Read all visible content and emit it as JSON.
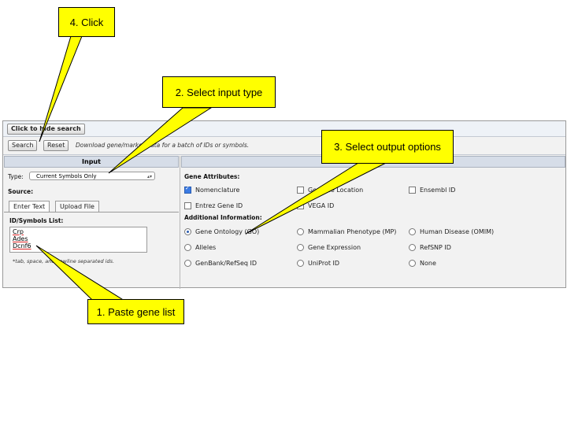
{
  "toolbar": {
    "hide_search_label": "Click to hide search",
    "search_label": "Search",
    "reset_label": "Reset",
    "hint": "Download gene/marker data for a batch of IDs or symbols."
  },
  "input_panel": {
    "header": "Input",
    "type_label": "Type:",
    "type_value": "Current Symbols Only",
    "source_label": "Source:",
    "tabs": [
      "Enter Text",
      "Upload File"
    ],
    "id_list_label": "ID/Symbols List:",
    "genes": [
      "Crp",
      "Ades",
      "Dcnf6"
    ],
    "note": "*tab, space, and newline separated ids."
  },
  "output_panel": {
    "gene_attributes_label": "Gene Attributes:",
    "attributes": [
      {
        "label": "Nomenclature",
        "checked": true
      },
      {
        "label": "Genome Location",
        "checked": false
      },
      {
        "label": "Ensembl ID",
        "checked": false
      },
      {
        "label": "Entrez Gene ID",
        "checked": false
      },
      {
        "label": "VEGA ID",
        "checked": false
      }
    ],
    "additional_label": "Additional Information:",
    "additional": [
      {
        "label": "Gene Ontology (GO)",
        "selected": true
      },
      {
        "label": "Mammalian Phenotype (MP)",
        "selected": false
      },
      {
        "label": "Human Disease (OMIM)",
        "selected": false
      },
      {
        "label": "Alleles",
        "selected": false
      },
      {
        "label": "Gene Expression",
        "selected": false
      },
      {
        "label": "RefSNP ID",
        "selected": false
      },
      {
        "label": "GenBank/RefSeq ID",
        "selected": false
      },
      {
        "label": "UniProt ID",
        "selected": false
      },
      {
        "label": "None",
        "selected": false
      }
    ]
  },
  "callouts": {
    "click": "4. Click",
    "select_input": "2. Select input type",
    "select_output": "3. Select output options",
    "paste": "1. Paste gene list"
  },
  "colors": {
    "callout_fill": "#ffff00",
    "header_fill": "#d6dde8",
    "checkbox_accent": "#3b7be4"
  }
}
